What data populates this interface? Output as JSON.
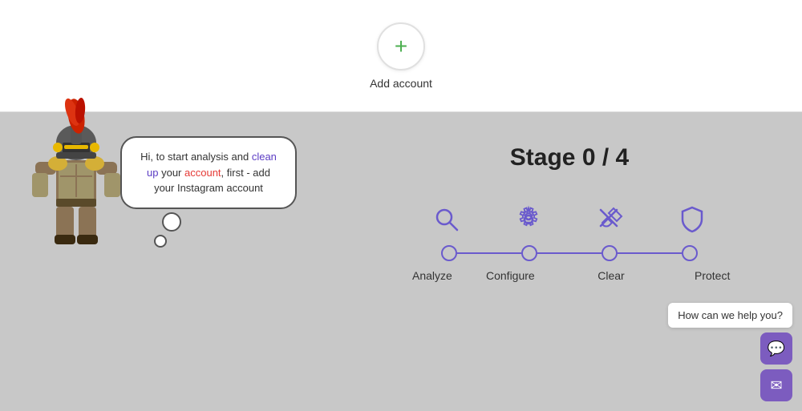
{
  "top": {
    "add_account_label": "Add account",
    "plus_symbol": "+"
  },
  "bottom": {
    "stage_title": "Stage 0 / 4",
    "speech_bubble": {
      "text_before": "Hi, to start analysis and ",
      "clean_up": "clean up",
      "text_middle": " your account, first - add your ",
      "instagram": "Instagram account"
    },
    "steps": [
      {
        "label": "Analyze",
        "icon": "analyze"
      },
      {
        "label": "Configure",
        "icon": "configure"
      },
      {
        "label": "Clear",
        "icon": "clear"
      },
      {
        "label": "Protect",
        "icon": "protect"
      }
    ],
    "chat": {
      "help_text": "How can we help you?",
      "chat_icon": "💬",
      "email_icon": "✉"
    }
  }
}
